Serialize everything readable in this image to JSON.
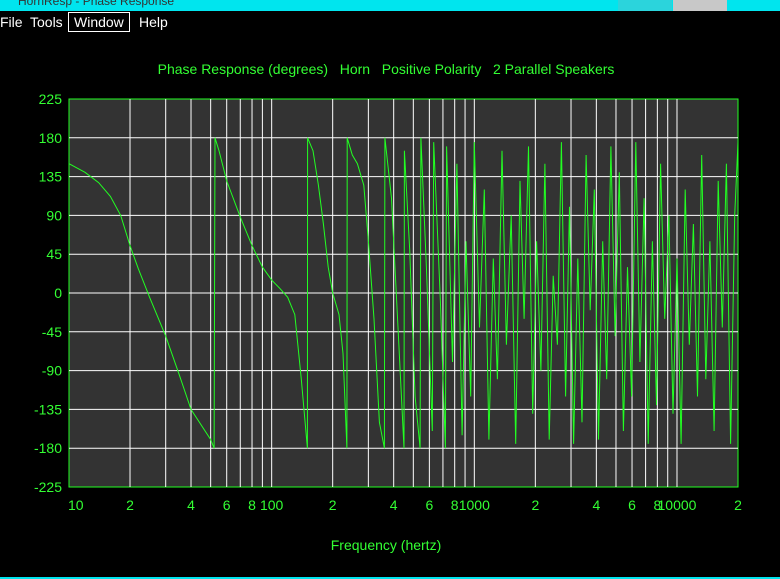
{
  "window": {
    "title": "HornResp - Phase Response",
    "titlebar_color": "#00e5ee"
  },
  "menu": {
    "items": [
      {
        "label": "File"
      },
      {
        "label": "Tools"
      },
      {
        "label": "Window",
        "active": true
      },
      {
        "label": "Help"
      }
    ]
  },
  "chart_data": {
    "type": "line",
    "title": "Phase Response (degrees)   Horn   Positive Polarity   2 Parallel Speakers",
    "xlabel": "Frequency (hertz)",
    "ylabel": "",
    "x_scale": "log",
    "xlim": [
      10,
      20000
    ],
    "ylim": [
      -225,
      225
    ],
    "y_ticks": [
      225,
      180,
      135,
      90,
      45,
      0,
      -45,
      -90,
      -135,
      -180,
      -225
    ],
    "x_tick_labels": [
      {
        "value": 10,
        "label": "10"
      },
      {
        "value": 20,
        "label": "2"
      },
      {
        "value": 40,
        "label": "4"
      },
      {
        "value": 60,
        "label": "6"
      },
      {
        "value": 80,
        "label": "8"
      },
      {
        "value": 100,
        "label": "100"
      },
      {
        "value": 200,
        "label": "2"
      },
      {
        "value": 400,
        "label": "4"
      },
      {
        "value": 600,
        "label": "6"
      },
      {
        "value": 800,
        "label": "8"
      },
      {
        "value": 1000,
        "label": "1000"
      },
      {
        "value": 2000,
        "label": "2"
      },
      {
        "value": 4000,
        "label": "4"
      },
      {
        "value": 6000,
        "label": "6"
      },
      {
        "value": 8000,
        "label": "8"
      },
      {
        "value": 10000,
        "label": "10000"
      },
      {
        "value": 20000,
        "label": "2"
      }
    ],
    "grid": true,
    "colors": {
      "background": "#000000",
      "plot_area": "#333333",
      "grid": "#ffffff",
      "text": "#33ff33",
      "line": "#22ff22"
    },
    "series": [
      {
        "points": [
          [
            10,
            150
          ],
          [
            12,
            140
          ],
          [
            14,
            128
          ],
          [
            16,
            112
          ],
          [
            18,
            90
          ],
          [
            20,
            55
          ],
          [
            22,
            28
          ],
          [
            25,
            -5
          ],
          [
            30,
            -50
          ],
          [
            35,
            -95
          ],
          [
            40,
            -135
          ],
          [
            50,
            -170
          ],
          [
            52,
            -180
          ],
          [
            52.5,
            180
          ],
          [
            55,
            165
          ],
          [
            60,
            130
          ],
          [
            70,
            88
          ],
          [
            80,
            55
          ],
          [
            90,
            30
          ],
          [
            100,
            15
          ],
          [
            110,
            5
          ],
          [
            120,
            -5
          ],
          [
            130,
            -25
          ],
          [
            140,
            -100
          ],
          [
            150,
            -180
          ],
          [
            150.5,
            180
          ],
          [
            160,
            165
          ],
          [
            170,
            125
          ],
          [
            180,
            80
          ],
          [
            190,
            30
          ],
          [
            200,
            0
          ],
          [
            215,
            -25
          ],
          [
            225,
            -70
          ],
          [
            235,
            -180
          ],
          [
            236,
            180
          ],
          [
            250,
            160
          ],
          [
            265,
            150
          ],
          [
            285,
            125
          ],
          [
            300,
            60
          ],
          [
            320,
            -30
          ],
          [
            340,
            -150
          ],
          [
            360,
            -180
          ],
          [
            362,
            180
          ],
          [
            390,
            110
          ],
          [
            420,
            -40
          ],
          [
            450,
            -180
          ],
          [
            452,
            165
          ],
          [
            480,
            50
          ],
          [
            510,
            -120
          ],
          [
            540,
            -180
          ],
          [
            545,
            180
          ],
          [
            580,
            30
          ],
          [
            620,
            -160
          ],
          [
            630,
            175
          ],
          [
            680,
            -10
          ],
          [
            720,
            -180
          ],
          [
            730,
            170
          ],
          [
            780,
            -80
          ],
          [
            820,
            150
          ],
          [
            870,
            -165
          ],
          [
            910,
            60
          ],
          [
            960,
            -120
          ],
          [
            1000,
            175
          ],
          [
            1060,
            -40
          ],
          [
            1120,
            120
          ],
          [
            1180,
            -170
          ],
          [
            1240,
            40
          ],
          [
            1300,
            -100
          ],
          [
            1370,
            165
          ],
          [
            1440,
            -60
          ],
          [
            1520,
            90
          ],
          [
            1600,
            -175
          ],
          [
            1680,
            130
          ],
          [
            1760,
            -30
          ],
          [
            1850,
            170
          ],
          [
            1940,
            -140
          ],
          [
            2030,
            60
          ],
          [
            2130,
            -90
          ],
          [
            2230,
            150
          ],
          [
            2340,
            -170
          ],
          [
            2450,
            20
          ],
          [
            2570,
            -60
          ],
          [
            2690,
            175
          ],
          [
            2820,
            -120
          ],
          [
            2950,
            100
          ],
          [
            3090,
            -175
          ],
          [
            3240,
            40
          ],
          [
            3400,
            -150
          ],
          [
            3560,
            160
          ],
          [
            3730,
            -20
          ],
          [
            3910,
            120
          ],
          [
            4100,
            -170
          ],
          [
            4300,
            60
          ],
          [
            4500,
            -100
          ],
          [
            4720,
            170
          ],
          [
            4950,
            -50
          ],
          [
            5190,
            140
          ],
          [
            5440,
            -160
          ],
          [
            5700,
            30
          ],
          [
            5970,
            -120
          ],
          [
            6260,
            175
          ],
          [
            6560,
            -80
          ],
          [
            6880,
            110
          ],
          [
            7210,
            -175
          ],
          [
            7560,
            60
          ],
          [
            7920,
            -130
          ],
          [
            8300,
            150
          ],
          [
            8700,
            -30
          ],
          [
            9120,
            90
          ],
          [
            9560,
            -140
          ],
          [
            10000,
            40
          ],
          [
            10480,
            -175
          ],
          [
            10980,
            120
          ],
          [
            11500,
            -60
          ],
          [
            12050,
            80
          ],
          [
            12630,
            -120
          ],
          [
            13240,
            160
          ],
          [
            13870,
            -100
          ],
          [
            14540,
            60
          ],
          [
            15240,
            -160
          ],
          [
            15970,
            130
          ],
          [
            16740,
            -40
          ],
          [
            17540,
            150
          ],
          [
            18380,
            -175
          ],
          [
            19260,
            90
          ],
          [
            20000,
            175
          ]
        ]
      }
    ]
  }
}
